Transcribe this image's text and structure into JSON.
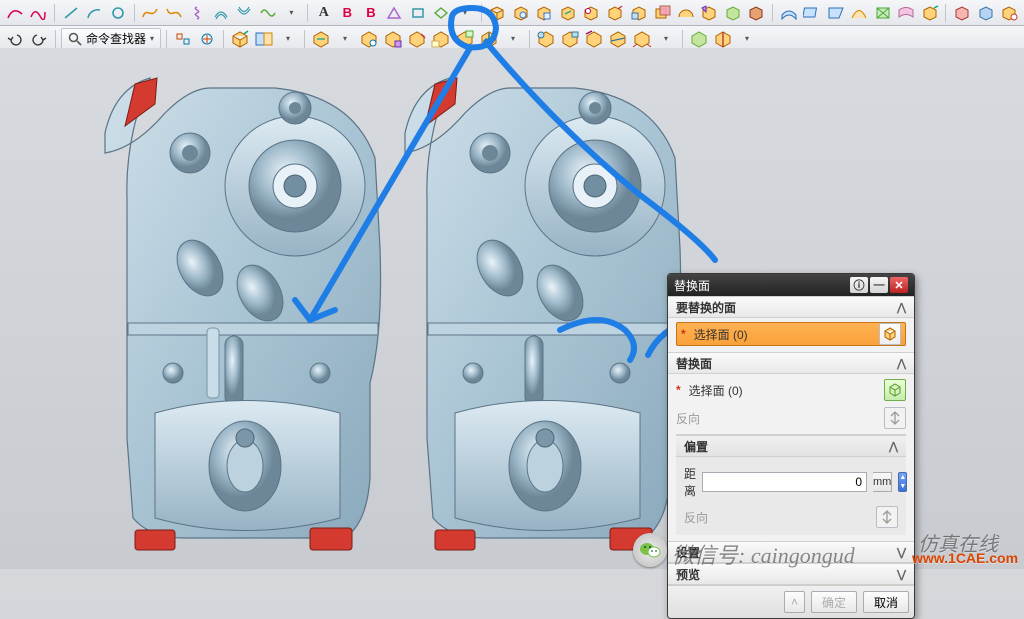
{
  "toolbar": {
    "command_finder_label": "命令查找器",
    "text_A": "A",
    "text_B": "B"
  },
  "panel": {
    "title": "替换面",
    "sections": {
      "faces_to_replace": "要替换的面",
      "replacement_face": "替换面",
      "offset": "偏置",
      "settings": "设置",
      "preview": "预览"
    },
    "select_face": "选择面 (0)",
    "reverse": "反向",
    "distance_label": "距离",
    "distance_value": "0",
    "distance_unit": "mm",
    "ok": "确定",
    "cancel": "取消"
  },
  "watermarks": {
    "wechat_prefix": "微信号",
    "wechat_id": "caingongud",
    "brand": "仿真在线",
    "url": "www.1CAE.com"
  }
}
